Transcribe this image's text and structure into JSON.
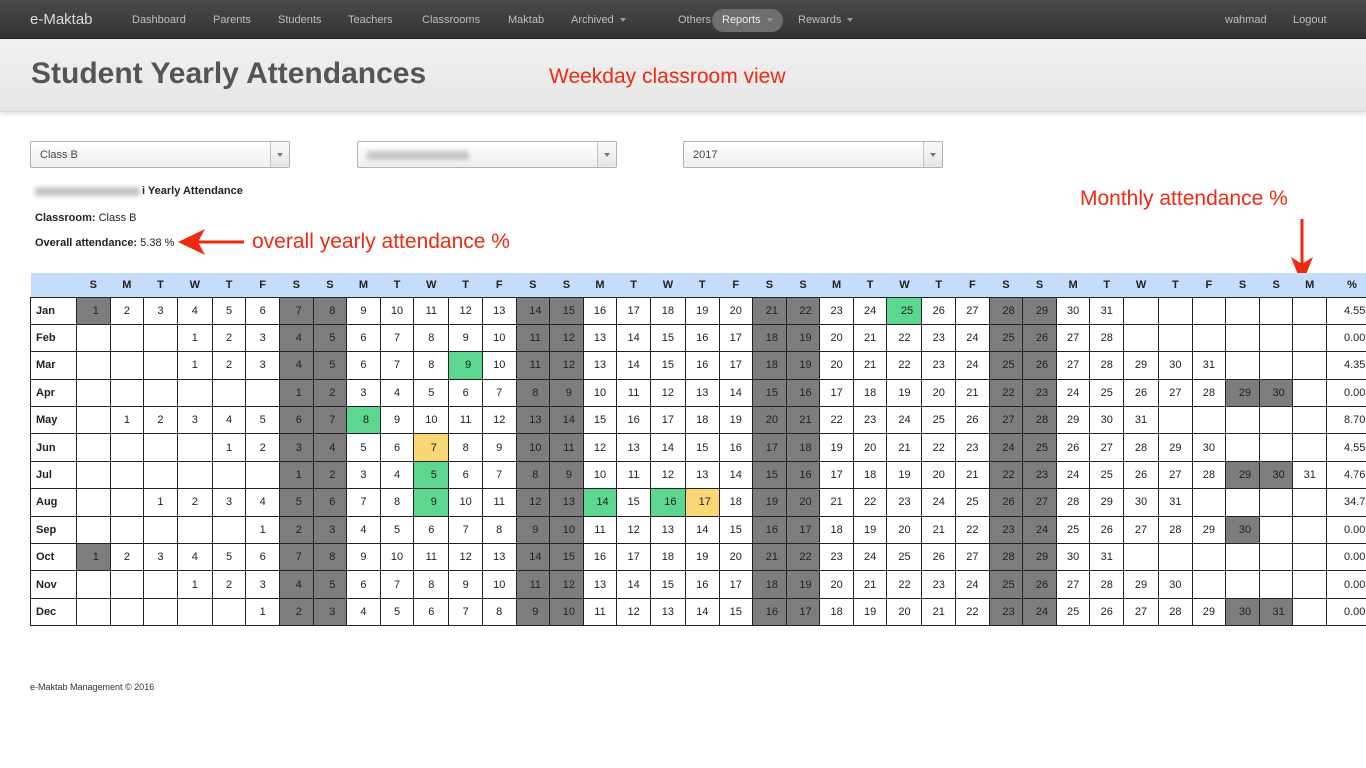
{
  "nav": {
    "brand": "e-Maktab",
    "items": [
      {
        "label": "Dashboard",
        "name": "dashboard",
        "dropdown": false,
        "active": false
      },
      {
        "label": "Parents",
        "name": "parents",
        "dropdown": false,
        "active": false
      },
      {
        "label": "Students",
        "name": "students",
        "dropdown": false,
        "active": false
      },
      {
        "label": "Teachers",
        "name": "teachers",
        "dropdown": false,
        "active": false
      },
      {
        "label": "Classrooms",
        "name": "classrooms",
        "dropdown": false,
        "active": false
      },
      {
        "label": "Maktab",
        "name": "maktab",
        "dropdown": false,
        "active": false
      },
      {
        "label": "Archived",
        "name": "archived",
        "dropdown": true,
        "active": false
      },
      {
        "label": "Others",
        "name": "others",
        "dropdown": true,
        "active": false
      },
      {
        "label": "Reports",
        "name": "reports",
        "dropdown": true,
        "active": true
      },
      {
        "label": "Rewards",
        "name": "rewards",
        "dropdown": true,
        "active": false
      }
    ],
    "user": "wahmad",
    "logout": "Logout"
  },
  "header": {
    "title": "Student Yearly Attendances",
    "annotation": "Weekday classroom view"
  },
  "filters": {
    "classroom": "Class B",
    "student": "",
    "year": "2017"
  },
  "summary": {
    "yearly_title_suffix": "i Yearly Attendance",
    "classroom_label": "Classroom:",
    "classroom_value": " Class B",
    "overall_label": "Overall attendance:",
    "overall_value": " 5.38 %"
  },
  "annotations": {
    "overall": "overall yearly attendance %",
    "monthly": "Monthly attendance %",
    "arrow_color": "#ee2a12"
  },
  "colors": {
    "weekend": "#7d7d7d",
    "present": "#5dd68f",
    "late": "#f8d774",
    "header_bg": "#c5dcfb"
  },
  "table": {
    "day_headers": [
      "S",
      "M",
      "T",
      "W",
      "T",
      "F",
      "S",
      "S",
      "M",
      "T",
      "W",
      "T",
      "F",
      "S",
      "S",
      "M",
      "T",
      "W",
      "T",
      "F",
      "S",
      "S",
      "M",
      "T",
      "W",
      "T",
      "F",
      "S",
      "S",
      "M",
      "T",
      "W",
      "T",
      "F",
      "S",
      "S",
      "M"
    ],
    "pct_header": "%",
    "months": [
      {
        "name": "Jan",
        "offset": 0,
        "days": 31,
        "pct": "4.55",
        "present": [
          25
        ],
        "late": []
      },
      {
        "name": "Feb",
        "offset": 3,
        "days": 28,
        "pct": "0.00",
        "present": [],
        "late": []
      },
      {
        "name": "Mar",
        "offset": 3,
        "days": 31,
        "pct": "4.35",
        "present": [
          9
        ],
        "late": []
      },
      {
        "name": "Apr",
        "offset": 6,
        "days": 30,
        "pct": "0.00",
        "present": [],
        "late": []
      },
      {
        "name": "May",
        "offset": 1,
        "days": 31,
        "pct": "8.70",
        "present": [
          8
        ],
        "late": []
      },
      {
        "name": "Jun",
        "offset": 4,
        "days": 30,
        "pct": "4.55",
        "present": [],
        "late": [
          7
        ]
      },
      {
        "name": "Jul",
        "offset": 6,
        "days": 31,
        "pct": "4.76",
        "present": [
          5
        ],
        "late": []
      },
      {
        "name": "Aug",
        "offset": 2,
        "days": 31,
        "pct": "34.78",
        "present": [
          9,
          14,
          16
        ],
        "late": [
          17
        ]
      },
      {
        "name": "Sep",
        "offset": 5,
        "days": 30,
        "pct": "0.00",
        "present": [],
        "late": []
      },
      {
        "name": "Oct",
        "offset": 0,
        "days": 31,
        "pct": "0.00",
        "present": [],
        "late": []
      },
      {
        "name": "Nov",
        "offset": 3,
        "days": 30,
        "pct": "0.00",
        "present": [],
        "late": []
      },
      {
        "name": "Dec",
        "offset": 5,
        "days": 31,
        "pct": "0.00",
        "present": [],
        "late": []
      }
    ]
  },
  "footer": "e-Maktab Management © 2016"
}
